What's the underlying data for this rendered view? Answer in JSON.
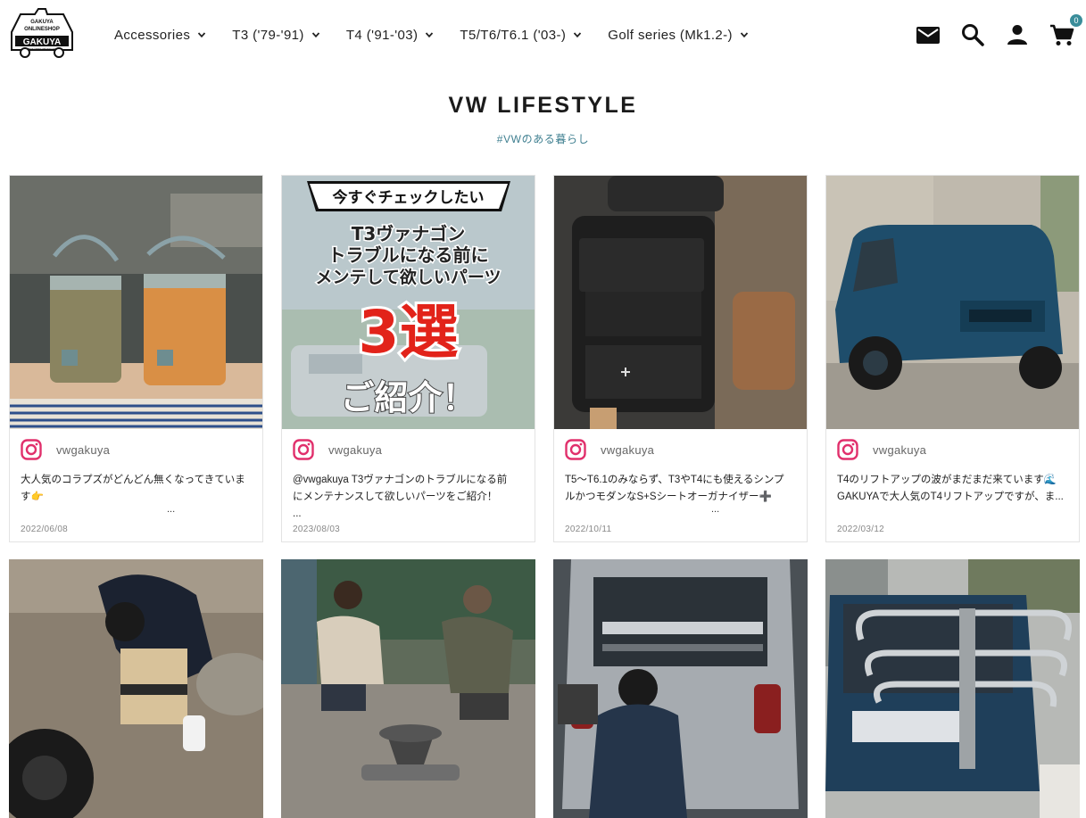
{
  "header": {
    "logo": {
      "line1": "GAKUYA",
      "line2": "ONLINESHOP",
      "brand": "GAKUYA",
      "url": "https://www.gakuya.com"
    },
    "nav": [
      {
        "label": "Accessories"
      },
      {
        "label": "T3 ('79-'91)"
      },
      {
        "label": "T4 ('91-'03)"
      },
      {
        "label": "T5/T6/T6.1 ('03-)"
      },
      {
        "label": "Golf series (Mk1.2-)"
      }
    ],
    "icons": [
      "mail-icon",
      "search-icon",
      "account-icon",
      "cart-icon"
    ],
    "cart_count": "0"
  },
  "section": {
    "title": "VW LIFESTYLE",
    "subtitle": "#VWのある暮らし"
  },
  "colors": {
    "accent": "#3f7f90",
    "badge": "#3a8d9a",
    "text": "#222222"
  },
  "posts": [
    {
      "handle": "vwgakuya",
      "line1": "大人気のコラプズがどんどん無くなってきていま",
      "line2": "す👉",
      "more": "...",
      "date": "2022/06/08",
      "image": "collapsible-buckets"
    },
    {
      "handle": "vwgakuya",
      "line1": "@vwgakuya T3ヴァナゴンのトラブルになる前",
      "line2": "にメンテナンスして欲しいパーツをご紹介！",
      "line3": "...",
      "date": "2023/08/03",
      "image": "promo-graphic",
      "promo": {
        "tag": "今すぐチェックしたい",
        "line1": "T3ヴァナゴン",
        "line2": "トラブルになる前に",
        "line3": "メンテして欲しいパーツ",
        "line4": "3選",
        "line5": "ご紹介！"
      }
    },
    {
      "handle": "vwgakuya",
      "line1": "T5〜T6.1のみならず、T3やT4にも使えるシンプ",
      "line2": "ルかつモダンなS+Sシートオーガナイザー➕",
      "more": "...",
      "date": "2022/10/11",
      "image": "seat-organizer"
    },
    {
      "handle": "vwgakuya",
      "line1": "T4のリフトアップの波がまだまだ来ています🌊",
      "line2": "",
      "line3": "GAKUYAで大人気のT4リフトアップですが、ま...",
      "date": "2022/03/12",
      "image": "blue-t4-van"
    },
    {
      "image": "man-with-stool"
    },
    {
      "image": "campfire-men"
    },
    {
      "image": "van-rear-bike-rack"
    },
    {
      "image": "blue-van-rack"
    }
  ]
}
